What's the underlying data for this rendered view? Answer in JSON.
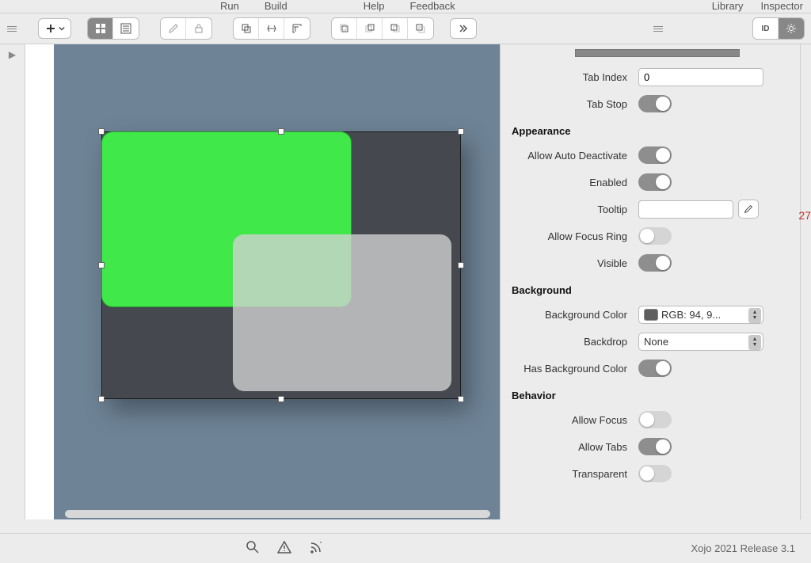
{
  "menu": {
    "items": [
      "Run",
      "Build",
      "Help",
      "Feedback"
    ],
    "right": [
      "Library",
      "Inspector"
    ]
  },
  "inspector": {
    "tabIndex": {
      "label": "Tab Index",
      "value": "0"
    },
    "tabStop": {
      "label": "Tab Stop",
      "on": true
    },
    "sections": {
      "appearance": {
        "title": "Appearance",
        "allowAutoDeactivate": {
          "label": "Allow Auto Deactivate",
          "on": true
        },
        "enabled": {
          "label": "Enabled",
          "on": true
        },
        "tooltip": {
          "label": "Tooltip",
          "value": ""
        },
        "allowFocusRing": {
          "label": "Allow Focus Ring",
          "on": false
        },
        "visible": {
          "label": "Visible",
          "on": true
        }
      },
      "background": {
        "title": "Background",
        "backgroundColor": {
          "label": "Background Color",
          "value": "RGB: 94, 9..."
        },
        "backdrop": {
          "label": "Backdrop",
          "value": "None"
        },
        "hasBackgroundColor": {
          "label": "Has Background Color",
          "on": true
        }
      },
      "behavior": {
        "title": "Behavior",
        "allowFocus": {
          "label": "Allow Focus",
          "on": false
        },
        "allowTabs": {
          "label": "Allow Tabs",
          "on": true
        },
        "transparent": {
          "label": "Transparent",
          "on": false
        }
      }
    }
  },
  "rightStrip": {
    "badge": "27"
  },
  "status": {
    "version": "Xojo 2021 Release 3.1"
  }
}
